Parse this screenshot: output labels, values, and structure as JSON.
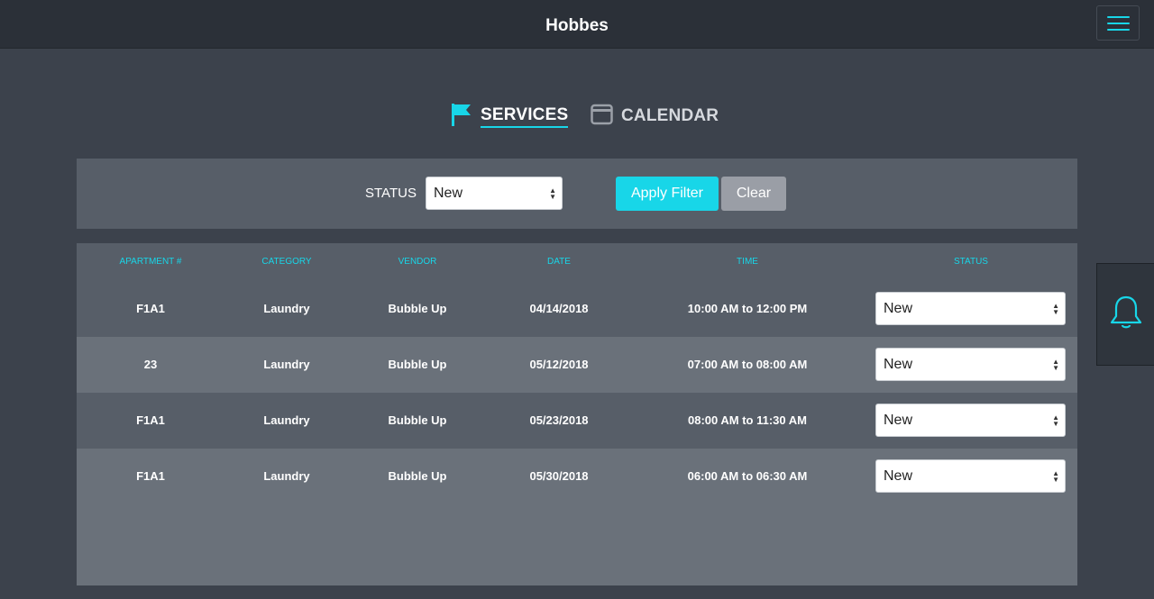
{
  "app": {
    "title": "Hobbes"
  },
  "colors": {
    "accent": "#18d6e8",
    "background": "#3c424c",
    "topbar": "#2b3038",
    "clear_button": "#9a9ea6"
  },
  "icons": {
    "menu": "hamburger-icon",
    "services": "flag-icon",
    "calendar": "calendar-icon",
    "notifications": "bell-icon"
  },
  "tabs": [
    {
      "label": "SERVICES",
      "active": true
    },
    {
      "label": "CALENDAR",
      "active": false
    }
  ],
  "filter": {
    "label": "STATUS",
    "selected": "New",
    "apply_label": "Apply Filter",
    "clear_label": "Clear"
  },
  "table": {
    "headers": [
      "APARTMENT #",
      "CATEGORY",
      "VENDOR",
      "DATE",
      "TIME",
      "STATUS"
    ],
    "rows": [
      {
        "apartment": "F1A1",
        "category": "Laundry",
        "vendor": "Bubble Up",
        "date": "04/14/2018",
        "time": "10:00 AM to 12:00 PM",
        "status": "New"
      },
      {
        "apartment": "23",
        "category": "Laundry",
        "vendor": "Bubble Up",
        "date": "05/12/2018",
        "time": "07:00 AM to 08:00 AM",
        "status": "New"
      },
      {
        "apartment": "F1A1",
        "category": "Laundry",
        "vendor": "Bubble Up",
        "date": "05/23/2018",
        "time": "08:00 AM to 11:30 AM",
        "status": "New"
      },
      {
        "apartment": "F1A1",
        "category": "Laundry",
        "vendor": "Bubble Up",
        "date": "05/30/2018",
        "time": "06:00 AM to 06:30 AM",
        "status": "New"
      }
    ]
  }
}
